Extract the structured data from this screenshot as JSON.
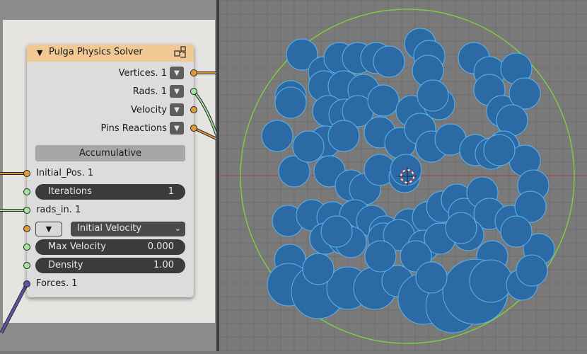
{
  "node": {
    "title": "Pulga Physics Solver",
    "collapse_icon": "chevron-down-icon",
    "header_icon": "node-tree-icon",
    "outputs": [
      {
        "label": "Vertices. 1",
        "socket_color": "#e09a3a"
      },
      {
        "label": "Rads. 1",
        "socket_color": "#a3e39d"
      },
      {
        "label": "Velocity",
        "socket_color": "#e09a3a"
      },
      {
        "label": "Pins Reactions",
        "socket_color": "#e09a3a"
      }
    ],
    "mode_button": "Accumulative",
    "inputs": {
      "initial_pos": "Initial_Pos. 1",
      "iterations": {
        "label": "Iterations",
        "value": "1"
      },
      "rads_in": "rads_in. 1",
      "initial_velocity": {
        "selected": "Initial Velocity"
      },
      "max_velocity": {
        "label": "Max Velocity",
        "value": "0.000"
      },
      "density": {
        "label": "Density",
        "value": "1.00"
      },
      "forces": "Forces. 1"
    }
  },
  "colors": {
    "header": "#f0c995",
    "node_body": "#dcdcdc",
    "vector_socket": "#e09a3a",
    "number_socket": "#a3e39d",
    "forces_socket": "#6353a6",
    "circle_fill": "#2b6aa4",
    "circle_outline": "#5ab4f0",
    "boundary": "#7fd63a",
    "viewport_bg": "#7a7a7a",
    "grid": "#6e6e6e",
    "x_axis": "#9b4a4a"
  }
}
